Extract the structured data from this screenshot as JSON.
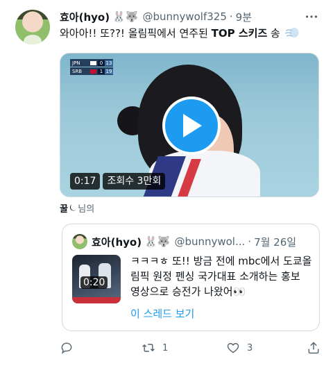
{
  "tweet": {
    "author_name": "효아(hyo)",
    "author_emojis": "🐰🐺",
    "handle": "@bunnywolf325",
    "separator": "·",
    "time": "9분",
    "text_prefix": "와아아!! 또??! 올림픽에서 연주된 ",
    "text_bold": "TOP 스키즈",
    "text_suffix": " 송"
  },
  "video": {
    "duration": "0:17",
    "views": "조회수 3만회",
    "scoreboard": [
      {
        "team": "JPN",
        "sets": "0",
        "points": "13"
      },
      {
        "team": "SRB",
        "sets": "1",
        "points": "19"
      }
    ]
  },
  "liked_by": {
    "name": "꿀",
    "moon": "⏾",
    "suffix": "님의"
  },
  "quote": {
    "author_name": "효아(hyo)",
    "author_emojis": "🐰🐺",
    "handle": "@bunnywol...",
    "separator": "·",
    "time": "7월 26일",
    "duration": "0:20",
    "text": "ㅋㅋㅋㅎ 또!! 방금 전에 mbc에서 도쿄올림픽 원정 펜싱 국가대표 소개하는 홍보 영상으로 승전가 나왔어👀",
    "show_thread": "이 스레드 보기"
  },
  "actions": {
    "reply_count": "",
    "retweet_count": "1",
    "like_count": "3"
  },
  "icons": {
    "more": "more-icon",
    "wind": "wind-face-icon",
    "play": "play-icon",
    "reply": "reply-icon",
    "retweet": "retweet-icon",
    "like": "heart-icon",
    "share": "share-icon"
  },
  "colors": {
    "accent": "#1d9bf0",
    "secondary_text": "#536471",
    "border": "#cfd9de"
  }
}
